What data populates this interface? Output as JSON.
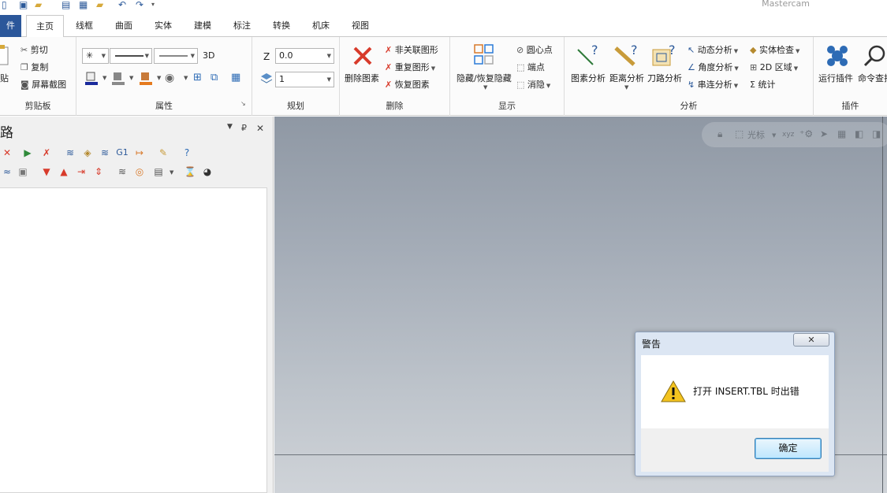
{
  "app": {
    "title": "Mastercam"
  },
  "tabs": [
    {
      "label": "件",
      "key": "file"
    },
    {
      "label": "主页",
      "key": "home"
    },
    {
      "label": "线框",
      "key": "wireframe"
    },
    {
      "label": "曲面",
      "key": "surfaces"
    },
    {
      "label": "实体",
      "key": "solids"
    },
    {
      "label": "建模",
      "key": "model"
    },
    {
      "label": "标注",
      "key": "drafting"
    },
    {
      "label": "转换",
      "key": "transform"
    },
    {
      "label": "机床",
      "key": "machine"
    },
    {
      "label": "视图",
      "key": "view"
    }
  ],
  "ribbon": {
    "clipboard": {
      "label": "剪贴板",
      "paste": "贴",
      "cut": "剪切",
      "copy": "复制",
      "screenshot": "屏幕截图"
    },
    "attributes": {
      "label": "属性",
      "mode_3d": "3D"
    },
    "planes": {
      "label": "规划",
      "z_label": "Z",
      "z_value": "0.0",
      "level_value": "1"
    },
    "delete": {
      "label": "删除",
      "delete_entities": "删除图素",
      "delete_non_assoc": "非关联图形",
      "duplicate": "重复图形",
      "restore": "恢复图素"
    },
    "display": {
      "label": "显示",
      "hide_unhide": "隐藏/恢复隐藏",
      "center_point": "圆心点",
      "endpoints": "端点",
      "blank": "消隐"
    },
    "analyze": {
      "label": "分析",
      "entity_analysis": "图素分析",
      "distance_analysis": "距离分析",
      "toolpath_analysis": "刀路分析",
      "dynamic": "动态分析",
      "angle": "角度分析",
      "chain": "串连分析",
      "solid_check": "实体检查",
      "area_2d": "2D 区域",
      "statistics": "统计"
    },
    "addins": {
      "label": "插件",
      "run_addin": "运行插件",
      "command_finder": "命令查找"
    }
  },
  "panel": {
    "title": "路"
  },
  "viewport_toolbar": {
    "cursor_label": "光标"
  },
  "dialog": {
    "title": "警告",
    "close_glyph": "✕",
    "message": "打开 INSERT.TBL 时出错",
    "ok_label": "确定"
  },
  "colors": {
    "accent": "#2b579a",
    "delete_red": "#d83b2b",
    "dialog_frame": "#dce6f3"
  }
}
